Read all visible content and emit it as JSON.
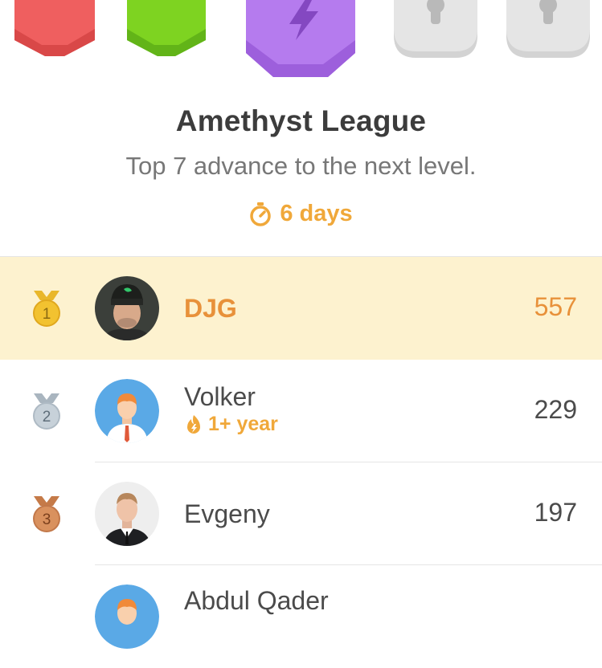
{
  "league": {
    "title": "Amethyst League",
    "subtitle": "Top 7 advance to the next level.",
    "timer": "6 days",
    "badges": [
      {
        "name": "ruby",
        "color": "#ef5f5f",
        "locked": false
      },
      {
        "name": "emerald",
        "color": "#7ed321",
        "locked": false
      },
      {
        "name": "amethyst",
        "color": "#b57bee",
        "locked": false,
        "current": true
      },
      {
        "name": "locked-1",
        "color": "#e5e5e5",
        "locked": true
      },
      {
        "name": "locked-2",
        "color": "#e5e5e5",
        "locked": true
      }
    ]
  },
  "leaderboard": [
    {
      "rank": "1",
      "name": "DJG",
      "xp": "557",
      "highlight": true,
      "medal": "gold",
      "avatar": "photo-beanie"
    },
    {
      "rank": "2",
      "name": "Volker",
      "xp": "229",
      "streak": "1+ year",
      "medal": "silver",
      "avatar": "default-avatar"
    },
    {
      "rank": "3",
      "name": "Evgeny",
      "xp": "197",
      "medal": "bronze",
      "avatar": "photo-suit"
    },
    {
      "rank": "",
      "name": "Abdul Qader",
      "xp": "",
      "medal": "none",
      "avatar": "default-avatar"
    }
  ],
  "colors": {
    "highlight_bg": "#fdf2cf",
    "accent_orange": "#e8913a",
    "timer_orange": "#f0a83a",
    "gold": "#f2c230",
    "silver": "#b8c4ce",
    "bronze": "#d08555"
  }
}
